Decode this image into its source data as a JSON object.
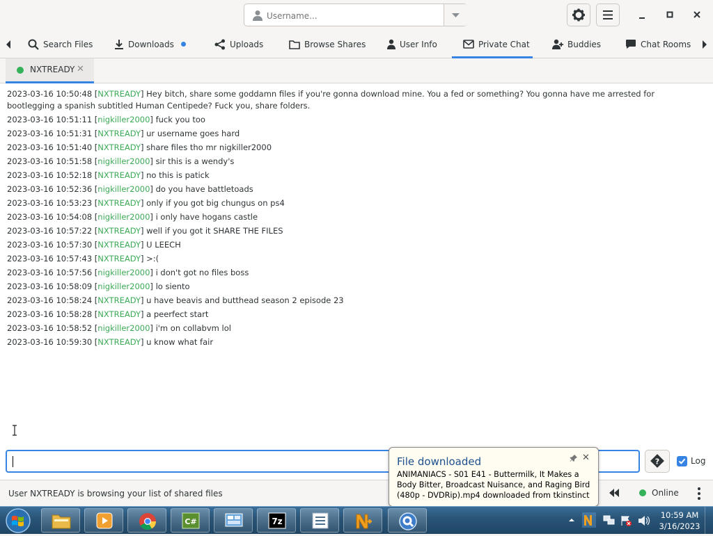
{
  "header": {
    "username_placeholder": "Username..."
  },
  "tabs": [
    {
      "label": "Search Files",
      "icon": "search-icon"
    },
    {
      "label": "Downloads",
      "icon": "download-icon",
      "badge": "dot"
    },
    {
      "label": "Uploads",
      "icon": "share-icon"
    },
    {
      "label": "Browse Shares",
      "icon": "folder-icon"
    },
    {
      "label": "User Info",
      "icon": "user-icon"
    },
    {
      "label": "Private Chat",
      "icon": "mail-icon",
      "active": true
    },
    {
      "label": "Buddies",
      "icon": "add-user-icon"
    },
    {
      "label": "Chat Rooms",
      "icon": "chat-bubble-icon"
    }
  ],
  "chat_tab": {
    "label": "NXTREADY",
    "status": "online"
  },
  "messages": [
    {
      "ts": "2023-03-16 10:50:48",
      "user": "NXTREADY",
      "text": "Hey bitch, share some goddamn files if you're gonna download mine. You a fed or something? You gonna have me arrested for bootlegging a spanish subtitled Human Centipede? Fuck you, share folders."
    },
    {
      "ts": "2023-03-16 10:51:11",
      "user": "nigkiller2000",
      "text": "fuck you too"
    },
    {
      "ts": "2023-03-16 10:51:31",
      "user": "NXTREADY",
      "text": "ur username goes hard"
    },
    {
      "ts": "2023-03-16 10:51:40",
      "user": "NXTREADY",
      "text": "share files tho mr nigkiller2000"
    },
    {
      "ts": "2023-03-16 10:51:58",
      "user": "nigkiller2000",
      "text": "sir this is a wendy's"
    },
    {
      "ts": "2023-03-16 10:52:18",
      "user": "NXTREADY",
      "text": "no this is patick"
    },
    {
      "ts": "2023-03-16 10:52:36",
      "user": "nigkiller2000",
      "text": "do you have battletoads"
    },
    {
      "ts": "2023-03-16 10:53:23",
      "user": "NXTREADY",
      "text": "only if you got big chungus on ps4"
    },
    {
      "ts": "2023-03-16 10:54:08",
      "user": "nigkiller2000",
      "text": "i only have hogans castle"
    },
    {
      "ts": "2023-03-16 10:57:22",
      "user": "NXTREADY",
      "text": "well if you got it SHARE THE FILES"
    },
    {
      "ts": "2023-03-16 10:57:30",
      "user": "NXTREADY",
      "text": "U LEECH"
    },
    {
      "ts": "2023-03-16 10:57:43",
      "user": "NXTREADY",
      "text": ">:("
    },
    {
      "ts": "2023-03-16 10:57:56",
      "user": "nigkiller2000",
      "text": "i don't got no files boss"
    },
    {
      "ts": "2023-03-16 10:58:09",
      "user": "nigkiller2000",
      "text": "lo siento"
    },
    {
      "ts": "2023-03-16 10:58:24",
      "user": "NXTREADY",
      "text": "u have beavis and butthead season 2 episode 23"
    },
    {
      "ts": "2023-03-16 10:58:28",
      "user": "NXTREADY",
      "text": "a peerfect start"
    },
    {
      "ts": "2023-03-16 10:58:52",
      "user": "nigkiller2000",
      "text": "i'm on collabvm lol"
    },
    {
      "ts": "2023-03-16 10:59:30",
      "user": "NXTREADY",
      "text": "u know what fair"
    }
  ],
  "input": {
    "value": "",
    "log_label": "Log",
    "log_checked": true
  },
  "status": {
    "text": "User NXTREADY is browsing your list of shared files",
    "online_label": "Online"
  },
  "notification": {
    "title": "File downloaded",
    "body": "ANIMANIACS - S01 E41 - Buttermilk, It Makes a Body Bitter, Broadcast Nuisance, and Raging Bird (480p - DVDRip).mp4 downloaded from tkinstinct"
  },
  "taskbar": {
    "apps": [
      "explorer-icon",
      "media-player-icon",
      "chrome-icon",
      "csharp-icon",
      "control-panel-icon",
      "7zip-icon",
      "list-app-icon",
      "nicotine-icon",
      "qbittorrent-icon"
    ],
    "time": "10:59 AM",
    "date": "3/16/2023"
  },
  "colors": {
    "accent": "#3584e4",
    "online": "#33b25a",
    "username": "#3daa58"
  }
}
